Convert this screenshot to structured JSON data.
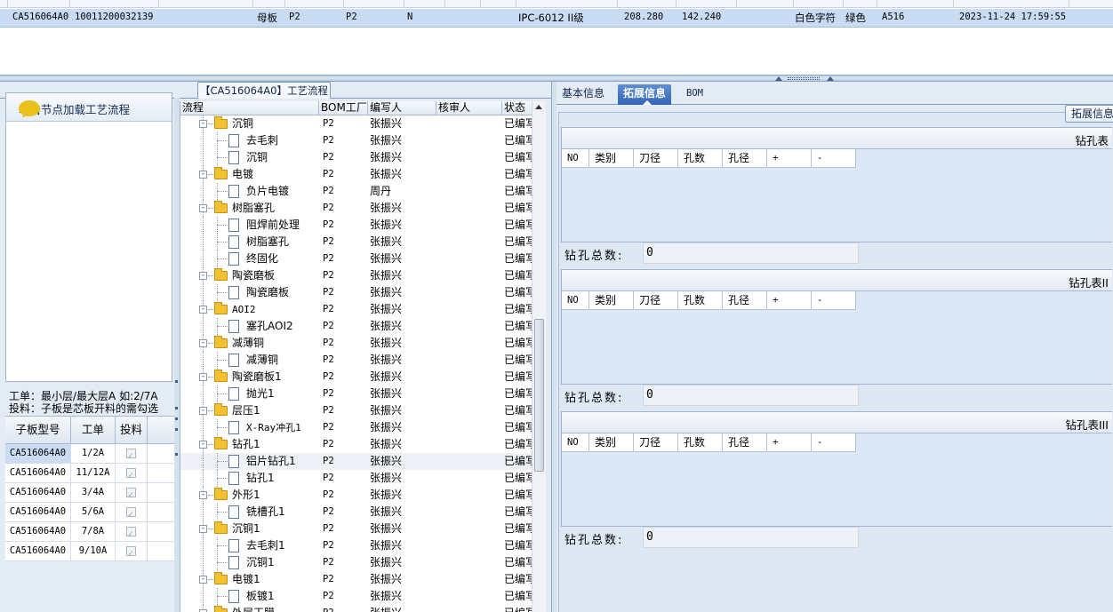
{
  "top_grid": {
    "selected_row": {
      "code": "CA516064A0",
      "number": "10011200032139",
      "board": "母板",
      "p1": "P2",
      "p2": "P2",
      "flag": "N",
      "material": "IPC-6012 II级",
      "width": "208.280",
      "height": "142.240",
      "legend": "白色字符",
      "mask": "绿色",
      "grade": "A516",
      "datetime": "2023-11-24 17:59:55"
    }
  },
  "process_tab": {
    "label": "【CA516064A0】工艺流程"
  },
  "load_box": {
    "label": "单击节点加载工艺流程"
  },
  "work_note": {
    "line1": "工单：最小层/最大层A 如:2/7A",
    "line2": "投料：子板是芯板开料的需勾选"
  },
  "sub_grid": {
    "headers": [
      "子板型号",
      "工单",
      "投料"
    ],
    "rows": [
      {
        "model": "CA516064A0",
        "order": "1/2A"
      },
      {
        "model": "CA516064A0",
        "order": "11/12A"
      },
      {
        "model": "CA516064A0",
        "order": "3/4A"
      },
      {
        "model": "CA516064A0",
        "order": "5/6A"
      },
      {
        "model": "CA516064A0",
        "order": "7/8A"
      },
      {
        "model": "CA516064A0",
        "order": "9/10A"
      }
    ]
  },
  "tree": {
    "headers": {
      "flow": "流程",
      "bom": "BOM工厂",
      "writer": "编写人",
      "checker": "核审人",
      "status": "状态"
    },
    "rows": [
      {
        "name": "沉铜",
        "kind": "folder",
        "bom": "P2",
        "writer": "张振兴",
        "status": "已编写"
      },
      {
        "name": "去毛刺",
        "kind": "doc",
        "bom": "P2",
        "writer": "张振兴",
        "status": "已编写"
      },
      {
        "name": "沉铜",
        "kind": "doc",
        "bom": "P2",
        "writer": "张振兴",
        "status": "已编写"
      },
      {
        "name": "电镀",
        "kind": "folder",
        "bom": "P2",
        "writer": "张振兴",
        "status": "已编写"
      },
      {
        "name": "负片电镀",
        "kind": "doc",
        "bom": "P2",
        "writer": "周丹",
        "status": "已编写"
      },
      {
        "name": "树脂塞孔",
        "kind": "folder",
        "bom": "P2",
        "writer": "张振兴",
        "status": "已编写"
      },
      {
        "name": "阻焊前处理",
        "kind": "doc",
        "bom": "P2",
        "writer": "张振兴",
        "status": "已编写"
      },
      {
        "name": "树脂塞孔",
        "kind": "doc",
        "bom": "P2",
        "writer": "张振兴",
        "status": "已编写"
      },
      {
        "name": "终固化",
        "kind": "doc",
        "bom": "P2",
        "writer": "张振兴",
        "status": "已编写"
      },
      {
        "name": "陶瓷磨板",
        "kind": "folder",
        "bom": "P2",
        "writer": "张振兴",
        "status": "已编写"
      },
      {
        "name": "陶瓷磨板",
        "kind": "doc",
        "bom": "P2",
        "writer": "张振兴",
        "status": "已编写"
      },
      {
        "name": "AOI2",
        "kind": "folder",
        "bom": "P2",
        "writer": "张振兴",
        "status": "已编写"
      },
      {
        "name": "塞孔AOI2",
        "kind": "doc",
        "bom": "P2",
        "writer": "张振兴",
        "status": "已编写"
      },
      {
        "name": "减薄铜",
        "kind": "folder",
        "bom": "P2",
        "writer": "张振兴",
        "status": "已编写"
      },
      {
        "name": "减薄铜",
        "kind": "doc",
        "bom": "P2",
        "writer": "张振兴",
        "status": "已编写"
      },
      {
        "name": "陶瓷磨板1",
        "kind": "folder",
        "bom": "P2",
        "writer": "张振兴",
        "status": "已编写"
      },
      {
        "name": "抛光1",
        "kind": "doc",
        "bom": "P2",
        "writer": "张振兴",
        "status": "已编写"
      },
      {
        "name": "层压1",
        "kind": "folder",
        "bom": "P2",
        "writer": "张振兴",
        "status": "已编写"
      },
      {
        "name": "X-Ray冲孔1",
        "kind": "doc",
        "bom": "P2",
        "writer": "张振兴",
        "status": "已编写"
      },
      {
        "name": "钻孔1",
        "kind": "folder",
        "bom": "P2",
        "writer": "张振兴",
        "status": "已编写"
      },
      {
        "name": "铝片钻孔1",
        "kind": "doc",
        "bom": "P2",
        "writer": "张振兴",
        "status": "已编写"
      },
      {
        "name": "钻孔1",
        "kind": "doc",
        "bom": "P2",
        "writer": "张振兴",
        "status": "已编写"
      },
      {
        "name": "外形1",
        "kind": "folder",
        "bom": "P2",
        "writer": "张振兴",
        "status": "已编写"
      },
      {
        "name": "铣槽孔1",
        "kind": "doc",
        "bom": "P2",
        "writer": "张振兴",
        "status": "已编写"
      },
      {
        "name": "沉铜1",
        "kind": "folder",
        "bom": "P2",
        "writer": "张振兴",
        "status": "已编写"
      },
      {
        "name": "去毛刺1",
        "kind": "doc",
        "bom": "P2",
        "writer": "张振兴",
        "status": "已编写"
      },
      {
        "name": "沉铜1",
        "kind": "doc",
        "bom": "P2",
        "writer": "张振兴",
        "status": "已编写"
      },
      {
        "name": "电镀1",
        "kind": "folder",
        "bom": "P2",
        "writer": "张振兴",
        "status": "已编写"
      },
      {
        "name": "板镀1",
        "kind": "doc",
        "bom": "P2",
        "writer": "张振兴",
        "status": "已编写"
      },
      {
        "name": "外层干膜",
        "kind": "folder",
        "bom": "P2",
        "writer": "张振兴",
        "status": "已编写"
      }
    ]
  },
  "tabs": [
    "基本信息",
    "拓展信息",
    "BOM"
  ],
  "expand_button": {
    "label": "拓展信息"
  },
  "drill_tables": [
    {
      "title": "钻孔表",
      "columns": [
        "NO",
        "类别",
        "刀径",
        "孔数",
        "孔径",
        "+",
        "-"
      ],
      "total_label": "钻孔总数:",
      "total_value": "0"
    },
    {
      "title": "钻孔表II",
      "columns": [
        "NO",
        "类别",
        "刀径",
        "孔数",
        "孔径",
        "+",
        "-"
      ],
      "total_label": "钻孔总数:",
      "total_value": "0"
    },
    {
      "title": "钻孔表III",
      "columns": [
        "NO",
        "类别",
        "刀径",
        "孔数",
        "孔径",
        "+",
        "-"
      ],
      "total_label": "钻孔总数:",
      "total_value": "0"
    }
  ]
}
